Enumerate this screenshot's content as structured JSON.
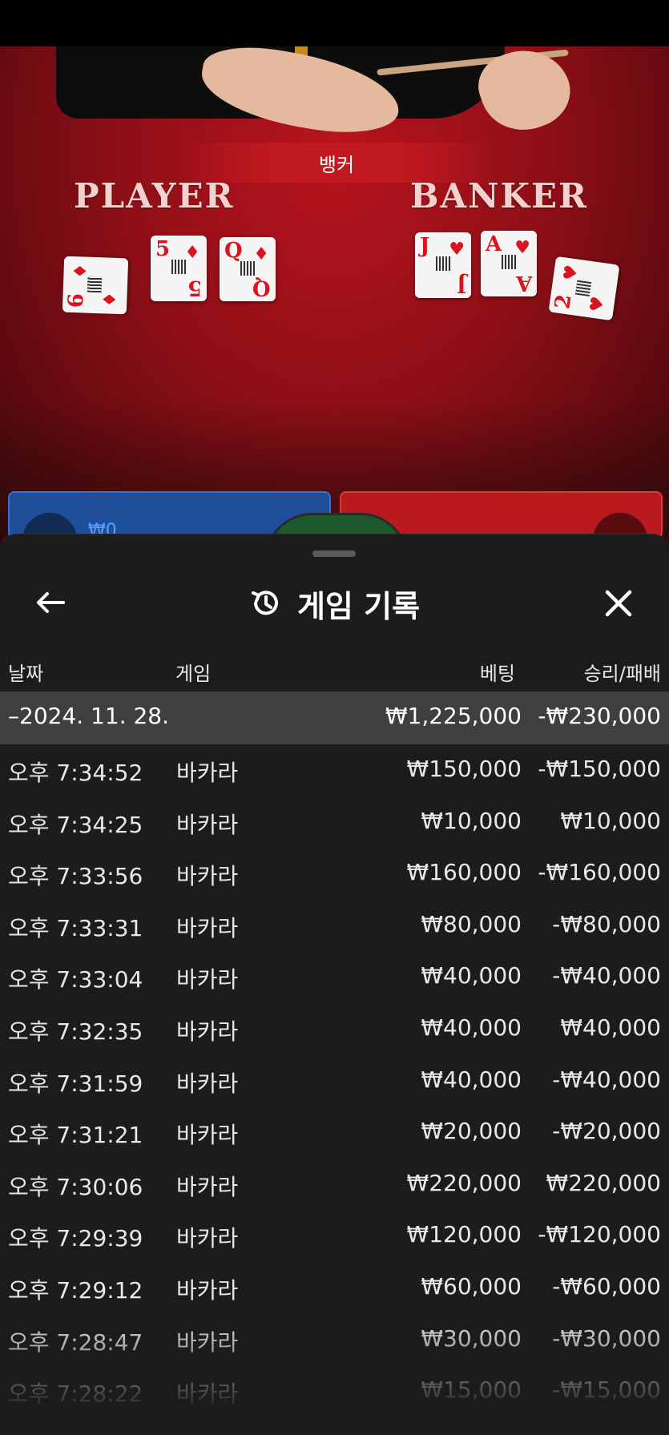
{
  "video": {
    "result_banner": "뱅커",
    "player_label": "PLAYER",
    "banker_label": "BANKER",
    "player_cards": [
      {
        "rank": "6",
        "suit": "♦"
      },
      {
        "rank": "5",
        "suit": "♦"
      },
      {
        "rank": "Q",
        "suit": "♦"
      }
    ],
    "banker_cards": [
      {
        "rank": "J",
        "suit": "♥"
      },
      {
        "rank": "A",
        "suit": "♥"
      },
      {
        "rank": "2",
        "suit": "♥"
      }
    ],
    "player_bet": "₩0"
  },
  "panel": {
    "title": "게임 기록",
    "back_icon": "arrow-left-icon",
    "history_icon": "history-icon",
    "close_icon": "close-icon",
    "columns": {
      "date": "날짜",
      "game": "게임",
      "bet": "베팅",
      "result": "승리/패배"
    },
    "summary": {
      "date": "–2024. 11. 28.",
      "bet": "₩1,225,000",
      "result": "-₩230,000"
    },
    "rows": [
      {
        "time": "오후 7:34:52",
        "game": "바카라",
        "bet": "₩150,000",
        "result": "-₩150,000"
      },
      {
        "time": "오후 7:34:25",
        "game": "바카라",
        "bet": "₩10,000",
        "result": "₩10,000"
      },
      {
        "time": "오후 7:33:56",
        "game": "바카라",
        "bet": "₩160,000",
        "result": "-₩160,000"
      },
      {
        "time": "오후 7:33:31",
        "game": "바카라",
        "bet": "₩80,000",
        "result": "-₩80,000"
      },
      {
        "time": "오후 7:33:04",
        "game": "바카라",
        "bet": "₩40,000",
        "result": "-₩40,000"
      },
      {
        "time": "오후 7:32:35",
        "game": "바카라",
        "bet": "₩40,000",
        "result": "₩40,000"
      },
      {
        "time": "오후 7:31:59",
        "game": "바카라",
        "bet": "₩40,000",
        "result": "-₩40,000"
      },
      {
        "time": "오후 7:31:21",
        "game": "바카라",
        "bet": "₩20,000",
        "result": "-₩20,000"
      },
      {
        "time": "오후 7:30:06",
        "game": "바카라",
        "bet": "₩220,000",
        "result": "₩220,000"
      },
      {
        "time": "오후 7:29:39",
        "game": "바카라",
        "bet": "₩120,000",
        "result": "-₩120,000"
      },
      {
        "time": "오후 7:29:12",
        "game": "바카라",
        "bet": "₩60,000",
        "result": "-₩60,000"
      },
      {
        "time": "오후 7:28:47",
        "game": "바카라",
        "bet": "₩30,000",
        "result": "-₩30,000"
      },
      {
        "time": "오후 7:28:22",
        "game": "바카라",
        "bet": "₩15,000",
        "result": "-₩15,000"
      }
    ]
  }
}
